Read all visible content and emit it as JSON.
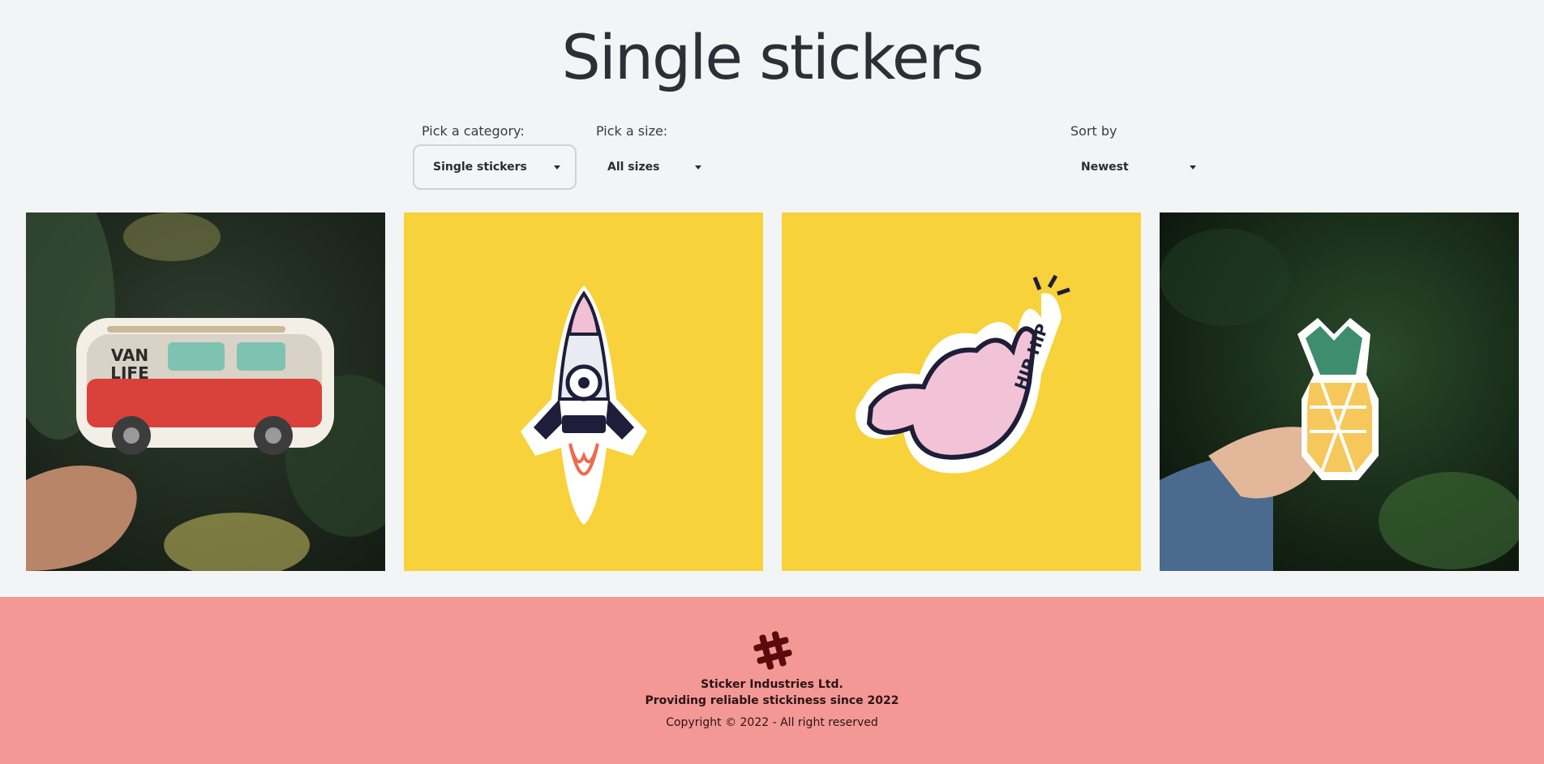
{
  "header": {
    "title": "Single stickers"
  },
  "filters": {
    "category": {
      "label": "Pick a category:",
      "value": "Single stickers"
    },
    "size": {
      "label": "Pick a size:",
      "value": "All sizes"
    },
    "sort": {
      "label": "Sort by",
      "value": "Newest"
    }
  },
  "products": [
    {
      "image": "van-life-sticker",
      "sticker_text": [
        "VAN",
        "LIFE"
      ]
    },
    {
      "image": "rocket-sticker"
    },
    {
      "image": "hand-hip-hip-sticker",
      "sticker_text": [
        "HIP HIP"
      ]
    },
    {
      "image": "pineapple-sticker"
    }
  ],
  "footer": {
    "logo": "hashtag-icon",
    "company": "Sticker Industries Ltd.",
    "tagline": "Providing reliable stickiness since 2022",
    "copyright": "Copyright © 2022 - All right reserved"
  },
  "colors": {
    "background": "#f3f4f6",
    "footer": "#f49895",
    "yellow_tile": "#f7d23a",
    "logo": "#5a0a0a"
  }
}
